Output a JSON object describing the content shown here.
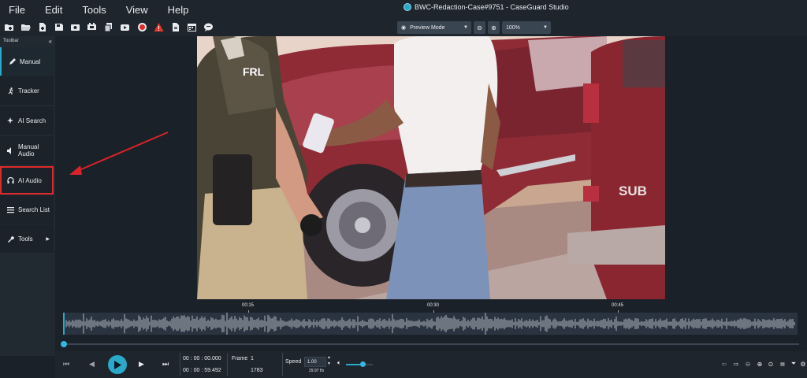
{
  "menu": [
    "File",
    "Edit",
    "Tools",
    "View",
    "Help"
  ],
  "window_title": "BWC-Redaction-Case#9751 - CaseGuard Studio",
  "toolbar": {
    "preview_mode": "Preview Mode",
    "zoom_level": "100%"
  },
  "sidebar": {
    "header": "Toolbar",
    "items": [
      {
        "label": "Manual"
      },
      {
        "label": "Tracker"
      },
      {
        "label": "AI Search"
      },
      {
        "label": "Manual Audio"
      },
      {
        "label": "AI Audio"
      },
      {
        "label": "Search List"
      },
      {
        "label": "Tools"
      }
    ]
  },
  "video": {
    "overlay_text": [
      "FRL",
      "SUB"
    ]
  },
  "timeline": {
    "marks": [
      "00:15",
      "00:30",
      "00:45"
    ]
  },
  "transport": {
    "current_time": "00 : 00 : 00.000",
    "total_time": "00 : 00 : 59.492",
    "frame_label": "Frame",
    "frame_value": "1",
    "frame_total": "1783",
    "speed_label": "Speed",
    "speed_value": "1.00",
    "fps": "29.97 f/s"
  },
  "colors": {
    "accent": "#2aa9c9",
    "highlight": "#e0292c",
    "background": "#1b2128"
  }
}
